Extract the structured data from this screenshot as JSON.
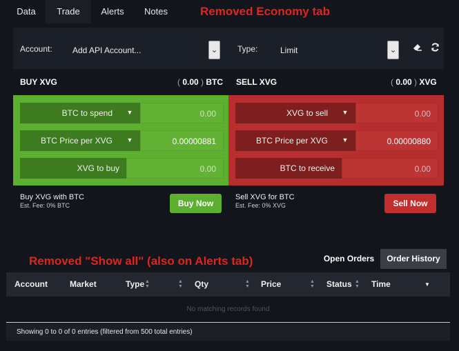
{
  "tabs": {
    "data": "Data",
    "trade": "Trade",
    "alerts": "Alerts",
    "notes": "Notes"
  },
  "annotations": {
    "economy_removed": "Removed Economy tab",
    "show_all_removed": "Removed \"Show all\" (also on Alerts tab)"
  },
  "controls": {
    "account_label": "Account:",
    "account_value": "Add API Account...",
    "type_label": "Type:",
    "type_value": "Limit",
    "dropdown_glyph": "⌄"
  },
  "buy": {
    "title": "BUY XVG",
    "balance_open": "( ",
    "balance_value": "0.00",
    "balance_close": " )",
    "balance_unit": "BTC",
    "fields": [
      {
        "label": "BTC to spend",
        "value": "0.00"
      },
      {
        "label": "BTC Price per XVG",
        "value": "0.00000881"
      },
      {
        "label": "XVG to buy",
        "value": "0.00"
      }
    ],
    "caption": "Buy XVG with BTC",
    "fee": "Est. Fee: 0% BTC",
    "button": "Buy Now"
  },
  "sell": {
    "title": "SELL XVG",
    "balance_open": "( ",
    "balance_value": "0.00",
    "balance_close": " )",
    "balance_unit": "XVG",
    "fields": [
      {
        "label": "XVG to sell",
        "value": "0.00"
      },
      {
        "label": "BTC Price per XVG",
        "value": "0.00000880"
      },
      {
        "label": "BTC to receive",
        "value": "0.00"
      }
    ],
    "caption": "Sell XVG for BTC",
    "fee": "Est. Fee: 0% XVG",
    "button": "Sell Now"
  },
  "orders": {
    "open_label": "Open Orders",
    "history_label": "Order History",
    "columns": [
      "Account",
      "Market",
      "Type",
      "Qty",
      "Price",
      "Status",
      "Time"
    ],
    "empty": "No matching records found",
    "info": "Showing 0 to 0 of 0 entries (filtered from 500 total entries)"
  },
  "icons": {
    "clear": "eraser-icon",
    "refresh": "refresh-icon",
    "dropdown": "caret-down-icon",
    "sort": "sort-icon"
  },
  "colors": {
    "buy": "#5daf30",
    "sell": "#b82e2e",
    "annotation": "#e0241f",
    "background": "#12151b"
  }
}
